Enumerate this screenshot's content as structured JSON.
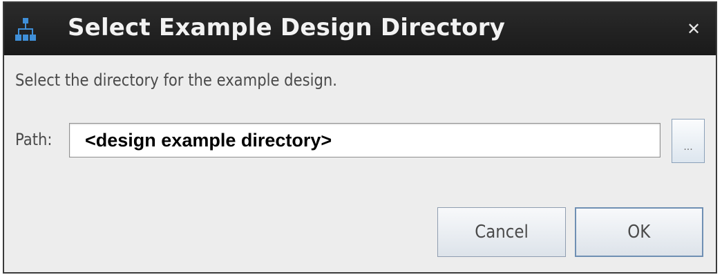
{
  "window": {
    "title": "Select Example Design Directory",
    "app_icon": "network-nodes-icon",
    "close_icon": "close-icon",
    "close_glyph": "✕"
  },
  "dialog": {
    "instruction": "Select the directory for the example design.",
    "path_label": "Path:",
    "path_value": "<design example directory>",
    "browse_label": "...",
    "cancel_label": "Cancel",
    "ok_label": "OK"
  },
  "colors": {
    "titlebar": "#1f1f1f",
    "body": "#ededed",
    "icon_blue": "#3f8fd8"
  }
}
